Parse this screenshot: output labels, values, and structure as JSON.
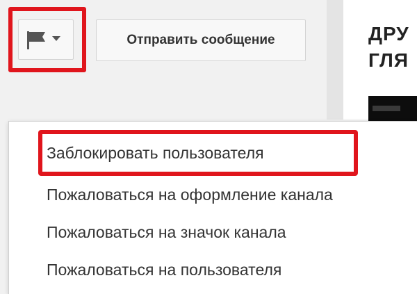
{
  "toolbar": {
    "flag_icon": "flag-icon",
    "dropdown_icon": "caret-down-icon",
    "send_message_label": "Отправить сообщение"
  },
  "sidebar": {
    "friends_title": "ДРУ\nГЛЯ"
  },
  "menu": {
    "items": [
      {
        "label": "Заблокировать пользователя",
        "highlighted": true
      },
      {
        "label": "Пожаловаться на оформление канала"
      },
      {
        "label": "Пожаловаться на значок канала"
      },
      {
        "label": "Пожаловаться на пользователя"
      }
    ]
  },
  "colors": {
    "highlight": "#e0151c",
    "menu_bg": "#ffffff",
    "page_bg": "#f1f1f1"
  }
}
